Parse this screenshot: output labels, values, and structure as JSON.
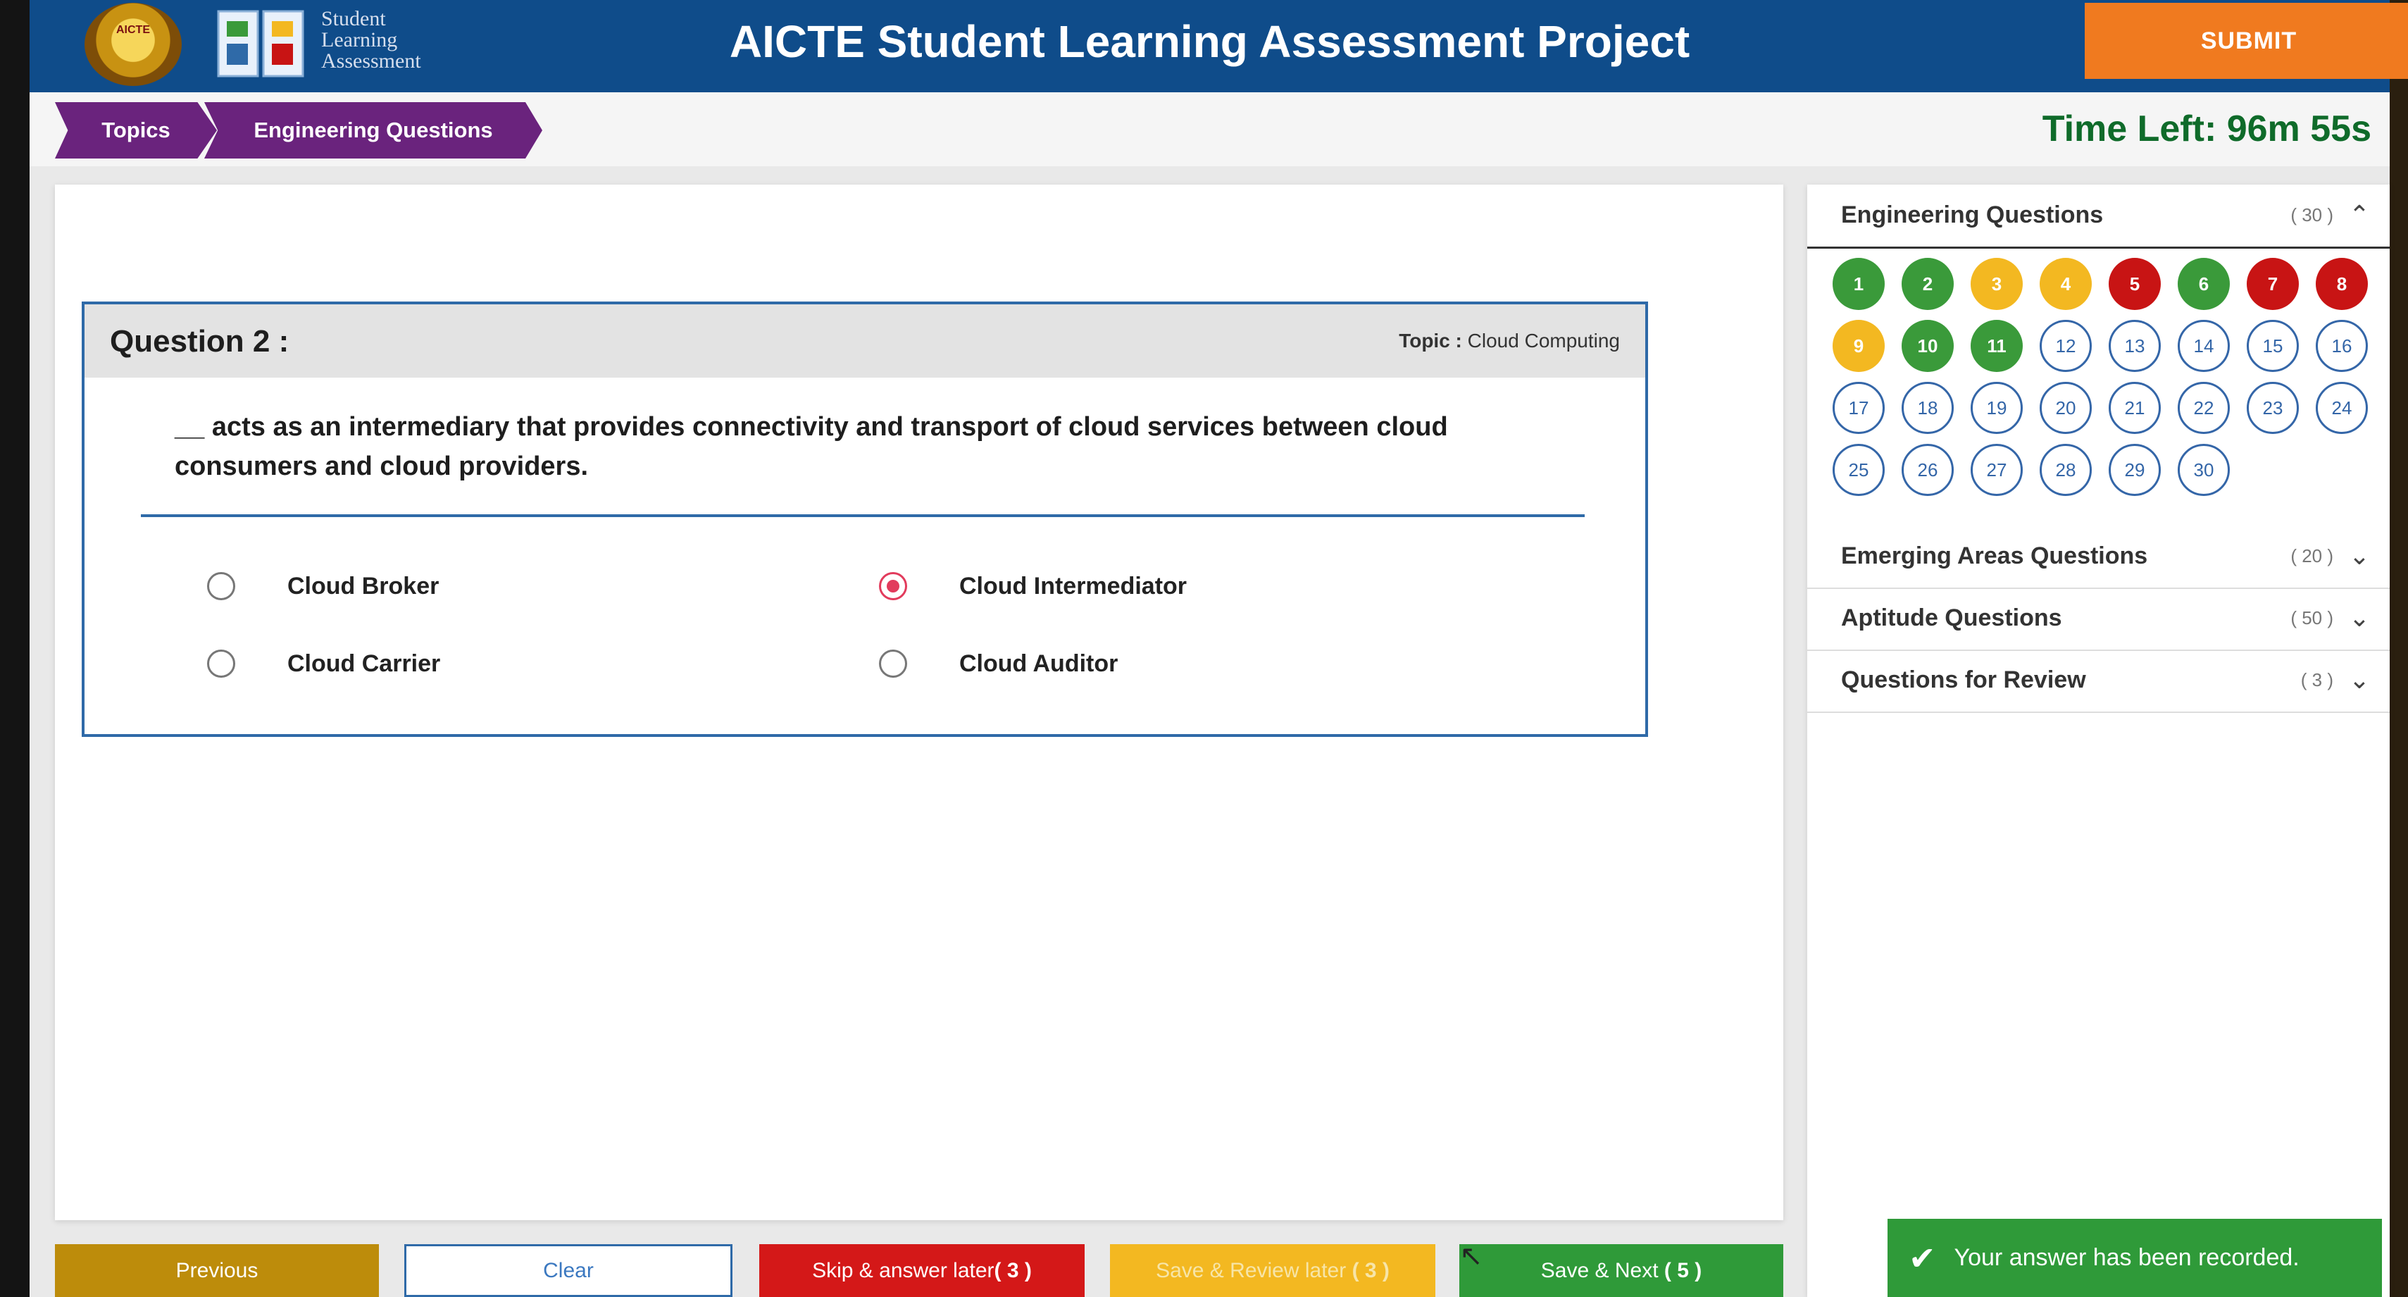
{
  "header": {
    "seal_text": "AICTE",
    "logo_lines": [
      "Student",
      "Learning",
      "Assessment"
    ],
    "title": "AICTE Student Learning Assessment Project",
    "submit_label": "SUBMIT"
  },
  "breadcrumb": [
    "Topics",
    "Engineering Questions"
  ],
  "timer": "Time Left: 96m 55s",
  "question": {
    "number_label": "Question 2 :",
    "topic_label": "Topic :",
    "topic_value": "Cloud Computing",
    "text": "__ acts as an intermediary that provides connectivity and transport of cloud services between cloud consumers and cloud providers.",
    "options": [
      {
        "label": "Cloud Broker",
        "selected": false
      },
      {
        "label": "Cloud Intermediator",
        "selected": true
      },
      {
        "label": "Cloud Carrier",
        "selected": false
      },
      {
        "label": "Cloud Auditor",
        "selected": false
      }
    ]
  },
  "actions": {
    "previous": "Previous",
    "clear": "Clear",
    "skip": "Skip & answer later",
    "skip_count": "( 3 )",
    "review": "Save & Review later",
    "review_count": "( 3 )",
    "next": "Save & Next",
    "next_count": "( 5 )"
  },
  "sections": [
    {
      "title": "Engineering Questions",
      "count": "( 30 )",
      "expanded": true,
      "chevron": "chevron-up-icon"
    },
    {
      "title": "Emerging Areas Questions",
      "count": "( 20 )",
      "expanded": false,
      "chevron": "chevron-down-icon"
    },
    {
      "title": "Aptitude Questions",
      "count": "( 50 )",
      "expanded": false,
      "chevron": "chevron-down-icon"
    },
    {
      "title": "Questions for Review",
      "count": "( 3 )",
      "expanded": false,
      "chevron": "chevron-down-icon"
    }
  ],
  "question_status": [
    {
      "n": "1",
      "status": "answered"
    },
    {
      "n": "2",
      "status": "answered"
    },
    {
      "n": "3",
      "status": "review"
    },
    {
      "n": "4",
      "status": "review"
    },
    {
      "n": "5",
      "status": "skipped"
    },
    {
      "n": "6",
      "status": "answered"
    },
    {
      "n": "7",
      "status": "skipped"
    },
    {
      "n": "8",
      "status": "skipped"
    },
    {
      "n": "9",
      "status": "review"
    },
    {
      "n": "10",
      "status": "answered"
    },
    {
      "n": "11",
      "status": "answered"
    },
    {
      "n": "12",
      "status": "unvisited"
    },
    {
      "n": "13",
      "status": "unvisited"
    },
    {
      "n": "14",
      "status": "unvisited"
    },
    {
      "n": "15",
      "status": "unvisited"
    },
    {
      "n": "16",
      "status": "unvisited"
    },
    {
      "n": "17",
      "status": "unvisited"
    },
    {
      "n": "18",
      "status": "unvisited"
    },
    {
      "n": "19",
      "status": "unvisited"
    },
    {
      "n": "20",
      "status": "unvisited"
    },
    {
      "n": "21",
      "status": "unvisited"
    },
    {
      "n": "22",
      "status": "unvisited"
    },
    {
      "n": "23",
      "status": "unvisited"
    },
    {
      "n": "24",
      "status": "unvisited"
    },
    {
      "n": "25",
      "status": "unvisited"
    },
    {
      "n": "26",
      "status": "unvisited"
    },
    {
      "n": "27",
      "status": "unvisited"
    },
    {
      "n": "28",
      "status": "unvisited"
    },
    {
      "n": "29",
      "status": "unvisited"
    },
    {
      "n": "30",
      "status": "unvisited"
    }
  ],
  "status_colors": {
    "answered": "#3a9a3a",
    "review": "#f3b821",
    "skipped": "#c81414",
    "unvisited": "#3466a8"
  },
  "toast": {
    "icon": "check-icon",
    "message": "Your answer has been recorded."
  }
}
